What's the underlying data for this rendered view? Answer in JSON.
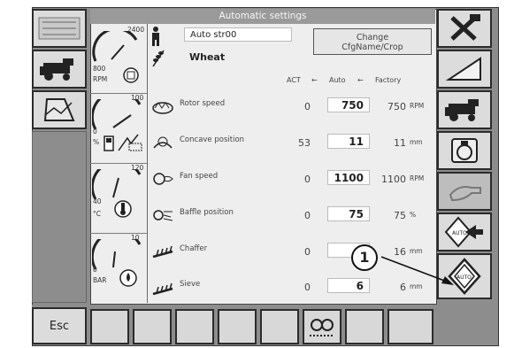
{
  "screen": {
    "title": "Automatic settings"
  },
  "profile": {
    "name": "Auto  str00",
    "crop": "Wheat"
  },
  "change_button": {
    "line1": "Change",
    "line2": "CfgName/Crop"
  },
  "columns": {
    "act": "ACT",
    "auto": "Auto",
    "factory": "Factory",
    "arrow": "←"
  },
  "gauges": [
    {
      "max": "2400",
      "min": "800",
      "unit": "RPM",
      "icon": "engine-icon",
      "level": 0.55
    },
    {
      "max": "100",
      "min": "0",
      "unit": "%",
      "icon": "fuel-icon",
      "level": 0.7
    },
    {
      "max": "120",
      "min": "40",
      "unit": "°C",
      "icon": "temperature-icon",
      "level": 0.45
    },
    {
      "max": "10",
      "min": "0",
      "unit": "BAR",
      "icon": "oil-pressure-icon",
      "level": 0.4
    }
  ],
  "params": [
    {
      "label": "Rotor speed",
      "act": "0",
      "auto": "750",
      "factory": "750",
      "unit": "RPM",
      "icon": "rotor-icon"
    },
    {
      "label": "Concave position",
      "act": "53",
      "auto": "11",
      "factory": "11",
      "unit": "mm",
      "icon": "concave-icon"
    },
    {
      "label": "Fan speed",
      "act": "0",
      "auto": "1100",
      "factory": "1100",
      "unit": "RPM",
      "icon": "fan-icon"
    },
    {
      "label": "Baffle position",
      "act": "0",
      "auto": "75",
      "factory": "75",
      "unit": "%",
      "icon": "baffle-icon"
    },
    {
      "label": "Chaffer",
      "act": "0",
      "auto": "1",
      "factory": "16",
      "unit": "mm",
      "icon": "chaffer-icon"
    },
    {
      "label": "Sieve",
      "act": "0",
      "auto": "6",
      "factory": "6",
      "unit": "mm",
      "icon": "sieve-icon"
    }
  ],
  "esc": {
    "label": "Esc"
  },
  "callout": {
    "number": "1"
  },
  "auto_badge": "AUTO",
  "icons": {
    "left": [
      "menu-grid-icon",
      "combine-icon",
      "field-map-icon"
    ],
    "right": [
      "tools-icon",
      "ramp-icon",
      "combine-icon",
      "engine-icon",
      "disabled-hand-icon",
      "auto-enter-icon",
      "auto-diamond-icon",
      "enter-icon"
    ],
    "bottom_center": "sieve-view-icon"
  }
}
